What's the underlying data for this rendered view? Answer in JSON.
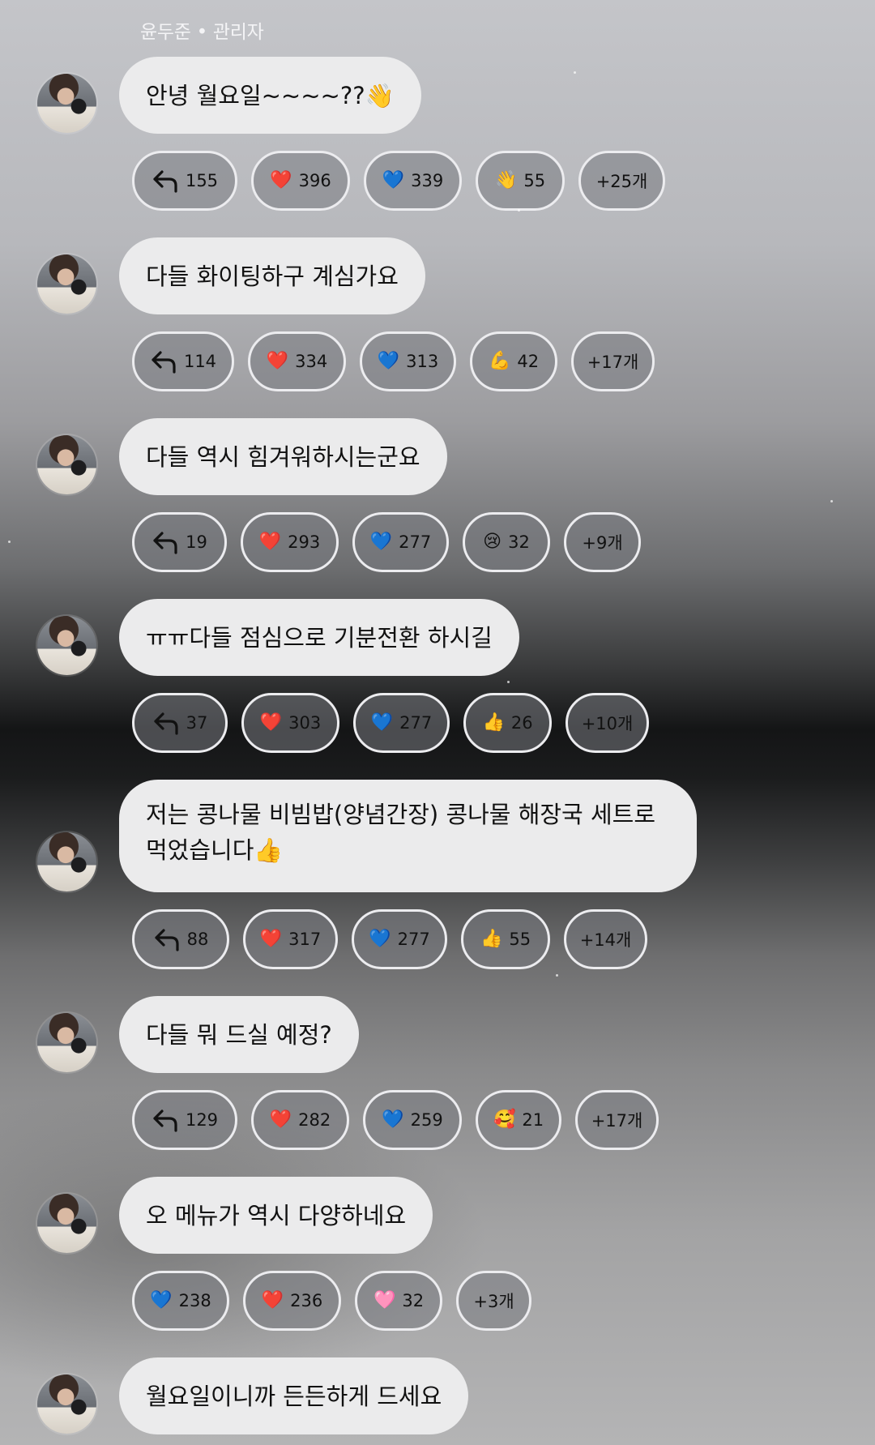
{
  "header": {
    "sender": "윤두준 • 관리자"
  },
  "messages": [
    {
      "text": "안녕 월요일~~~~??👋",
      "reactions": [
        {
          "type": "reply",
          "count": "155"
        },
        {
          "emoji": "❤️",
          "count": "396"
        },
        {
          "emoji": "💙",
          "count": "339"
        },
        {
          "emoji": "👋",
          "count": "55"
        },
        {
          "type": "more",
          "label": "+25개"
        }
      ]
    },
    {
      "text": "다들 화이팅하구 계심가요",
      "reactions": [
        {
          "type": "reply",
          "count": "114"
        },
        {
          "emoji": "❤️",
          "count": "334"
        },
        {
          "emoji": "💙",
          "count": "313"
        },
        {
          "emoji": "💪",
          "count": "42"
        },
        {
          "type": "more",
          "label": "+17개"
        }
      ]
    },
    {
      "text": "다들 역시 힘겨워하시는군요",
      "reactions": [
        {
          "type": "reply",
          "count": "19"
        },
        {
          "emoji": "❤️",
          "count": "293"
        },
        {
          "emoji": "💙",
          "count": "277"
        },
        {
          "emoji": "😢",
          "count": "32"
        },
        {
          "type": "more",
          "label": "+9개"
        }
      ]
    },
    {
      "text": "ㅠㅠ다들 점심으로 기분전환 하시길",
      "reactions": [
        {
          "type": "reply",
          "count": "37"
        },
        {
          "emoji": "❤️",
          "count": "303"
        },
        {
          "emoji": "💙",
          "count": "277"
        },
        {
          "emoji": "👍",
          "count": "26"
        },
        {
          "type": "more",
          "label": "+10개"
        }
      ]
    },
    {
      "text": "저는 콩나물 비빔밥(양념간장) 콩나물 해장국 세트로 먹었습니다👍",
      "reactions": [
        {
          "type": "reply",
          "count": "88"
        },
        {
          "emoji": "❤️",
          "count": "317"
        },
        {
          "emoji": "💙",
          "count": "277"
        },
        {
          "emoji": "👍",
          "count": "55"
        },
        {
          "type": "more",
          "label": "+14개"
        }
      ]
    },
    {
      "text": "다들 뭐 드실 예정?",
      "reactions": [
        {
          "type": "reply",
          "count": "129"
        },
        {
          "emoji": "❤️",
          "count": "282"
        },
        {
          "emoji": "💙",
          "count": "259"
        },
        {
          "emoji": "🥰",
          "count": "21"
        },
        {
          "type": "more",
          "label": "+17개"
        }
      ]
    },
    {
      "text": "오 메뉴가 역시 다양하네요",
      "reactions": [
        {
          "emoji": "💙",
          "count": "238"
        },
        {
          "emoji": "❤️",
          "count": "236"
        },
        {
          "emoji": "🩷",
          "count": "32"
        },
        {
          "type": "more",
          "label": "+3개"
        }
      ]
    },
    {
      "text": "월요일이니까 든든하게 드세요",
      "reactions": []
    }
  ]
}
